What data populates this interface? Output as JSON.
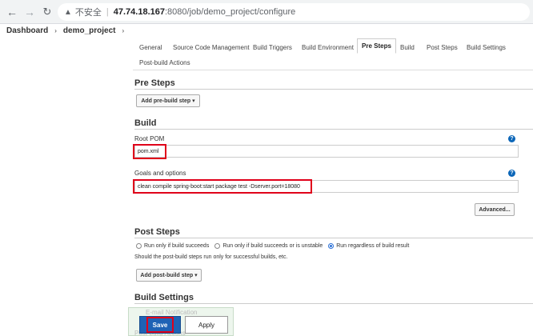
{
  "browser": {
    "insecure_label": "不安全",
    "url_host": "47.74.18.167",
    "url_path": ":8080/job/demo_project/configure"
  },
  "breadcrumb": [
    {
      "label": "Dashboard"
    },
    {
      "label": "demo_project"
    }
  ],
  "tabs": [
    {
      "label": "General"
    },
    {
      "label": "Source Code Management"
    },
    {
      "label": "Build Triggers"
    },
    {
      "label": "Build Environment"
    },
    {
      "label": "Pre Steps",
      "active": true
    },
    {
      "label": "Build"
    },
    {
      "label": "Post Steps"
    },
    {
      "label": "Build Settings"
    },
    {
      "label": "Post-build Actions"
    }
  ],
  "pre_steps": {
    "title": "Pre Steps",
    "add_button": "Add pre-build step ▾"
  },
  "build": {
    "title": "Build",
    "root_pom_label": "Root POM",
    "root_pom_value": "pom.xml",
    "goals_label": "Goals and options",
    "goals_value": "clean compile spring-boot:start package test -Dserver.port=18080",
    "advanced_button": "Advanced..."
  },
  "post_steps": {
    "title": "Post Steps",
    "options": [
      {
        "label": "Run only if build succeeds",
        "checked": false
      },
      {
        "label": "Run only if build succeeds or is unstable",
        "checked": false
      },
      {
        "label": "Run regardless of build result",
        "checked": true
      }
    ],
    "note": "Should the post-build steps run only for successful builds, etc.",
    "add_button": "Add post-build step ▾"
  },
  "build_settings": {
    "title": "Build Settings",
    "email_ghost": "E-mail Notification",
    "post_build_ghost": "Post-build Actions"
  },
  "footer": {
    "save_label": "Save",
    "apply_label": "Apply"
  },
  "colors": {
    "accent": "#1f62b5",
    "highlight": "#e0001a",
    "help": "#0b66b8"
  }
}
